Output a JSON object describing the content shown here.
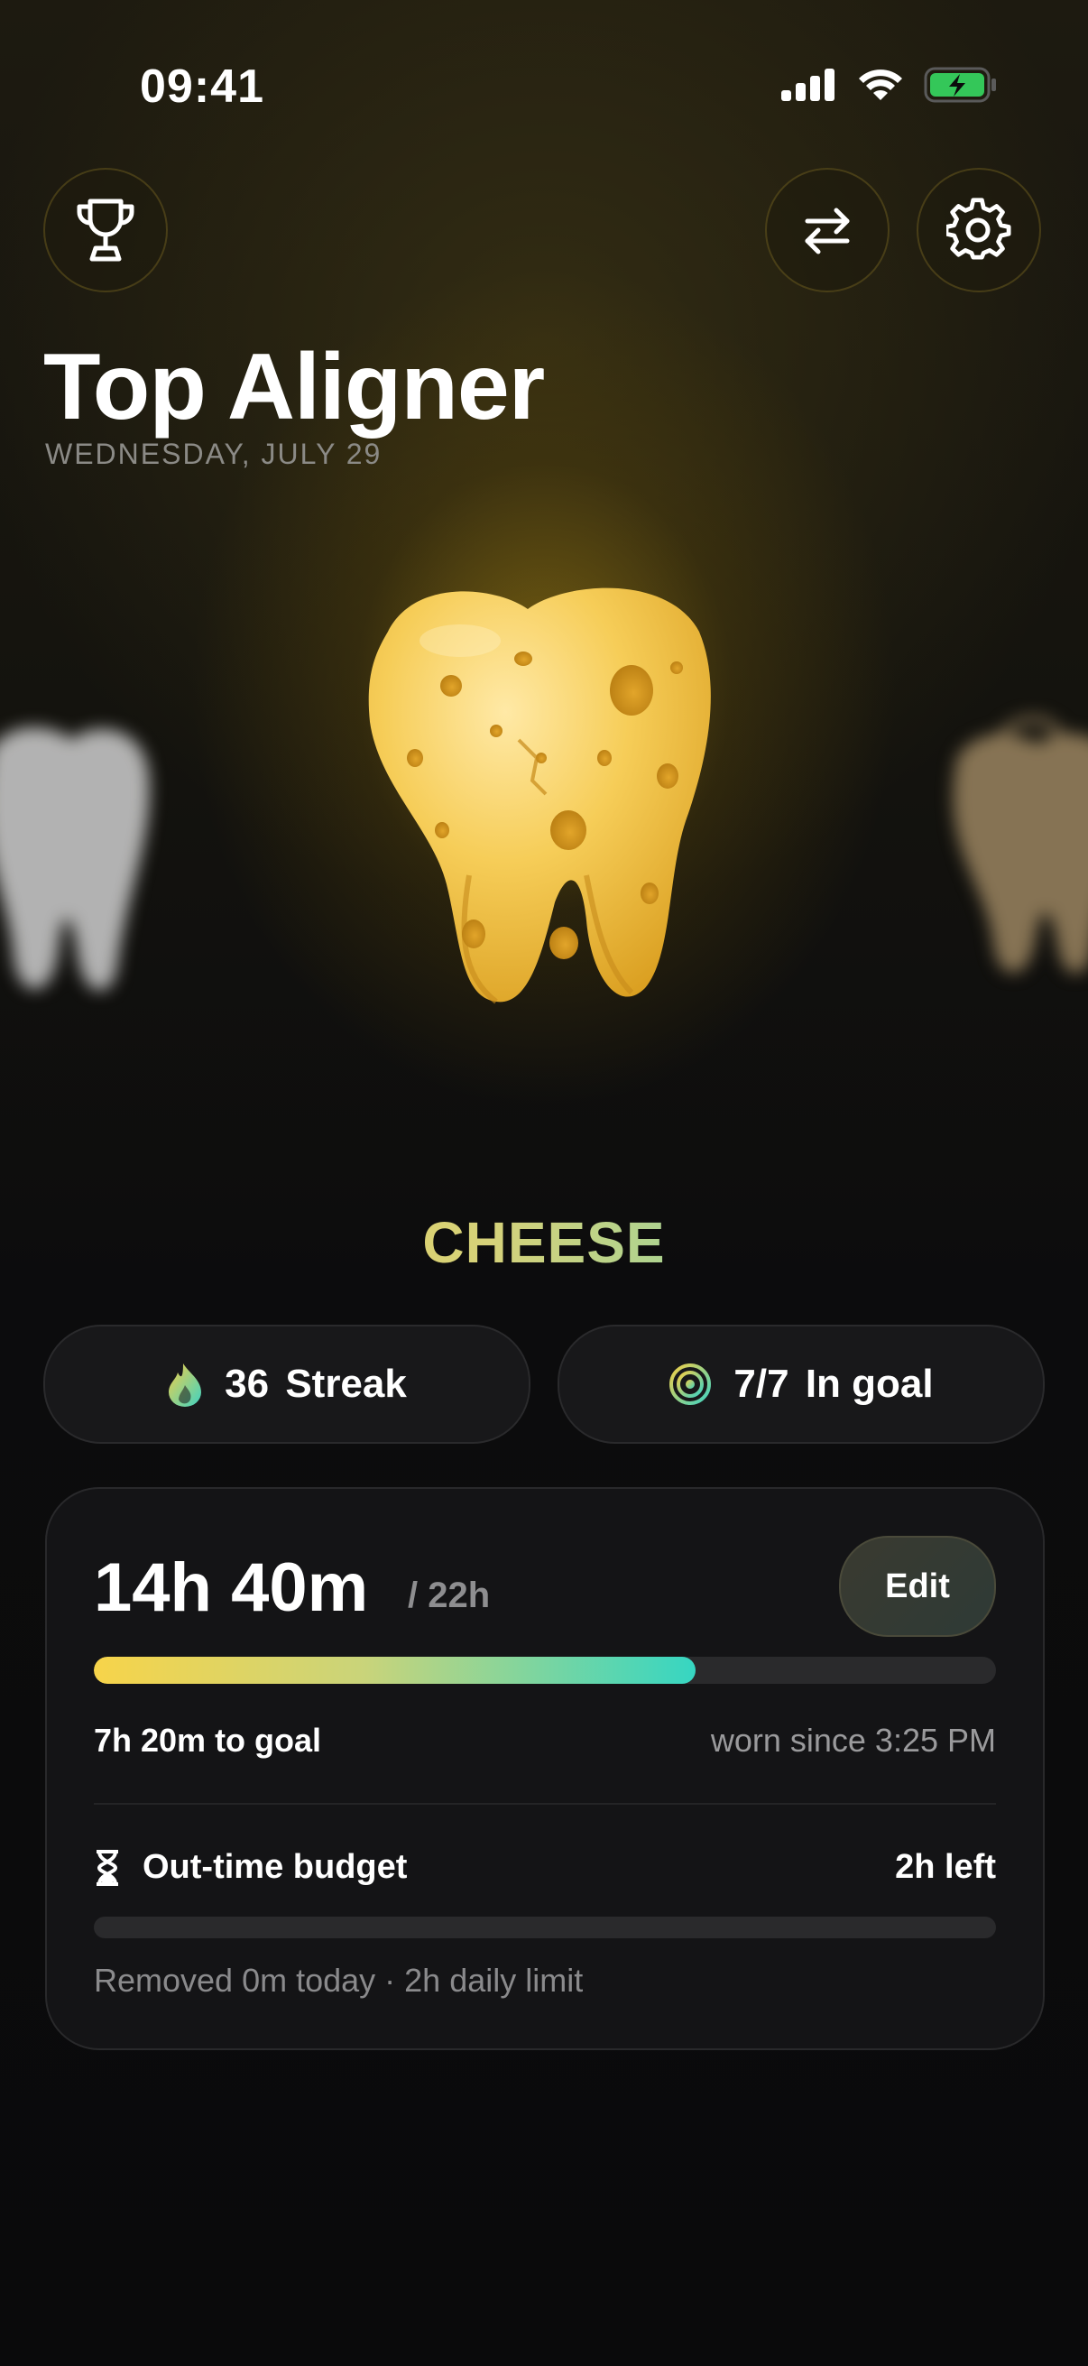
{
  "status_bar": {
    "time": "09:41"
  },
  "header": {
    "title": "Top Aligner",
    "date": "WEDNESDAY, JULY 29"
  },
  "carousel": {
    "current_name": "CHEESE"
  },
  "stats": {
    "streak": {
      "value": "36",
      "label": "Streak"
    },
    "goal": {
      "value": "7/7",
      "label": "In goal"
    }
  },
  "wear": {
    "worn": "14h 40m",
    "target": "/ 22h",
    "edit_label": "Edit",
    "progress_fraction": 0.667,
    "to_goal": "7h 20m to goal",
    "worn_since": "worn since 3:25 PM"
  },
  "budget": {
    "label": "Out-time budget",
    "left": "2h left",
    "progress_fraction": 0,
    "note": "Removed 0m today · 2h daily limit"
  },
  "colors": {
    "accent_start": "#f7d44a",
    "accent_end": "#36d6c2",
    "battery": "#34c759"
  }
}
